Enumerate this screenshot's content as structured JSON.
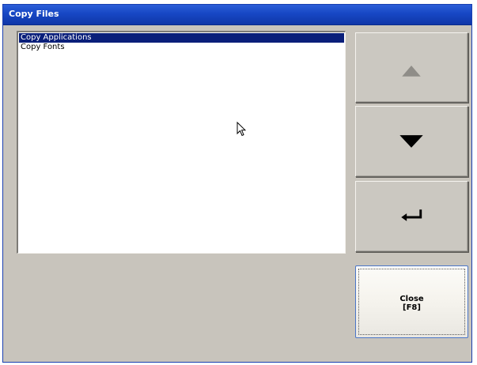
{
  "window": {
    "title": "Copy Files"
  },
  "list": {
    "items": [
      {
        "label": "Copy Applications",
        "selected": true
      },
      {
        "label": "Copy Fonts",
        "selected": false
      }
    ]
  },
  "buttons": {
    "up_icon": "up-triangle-icon",
    "down_icon": "down-triangle-icon",
    "enter_icon": "enter-arrow-icon",
    "close_label": "Close",
    "close_shortcut": "[F8]"
  },
  "colors": {
    "titlebar": "#1747c4",
    "selection": "#0a1f7a",
    "background": "#c8c4bc"
  }
}
